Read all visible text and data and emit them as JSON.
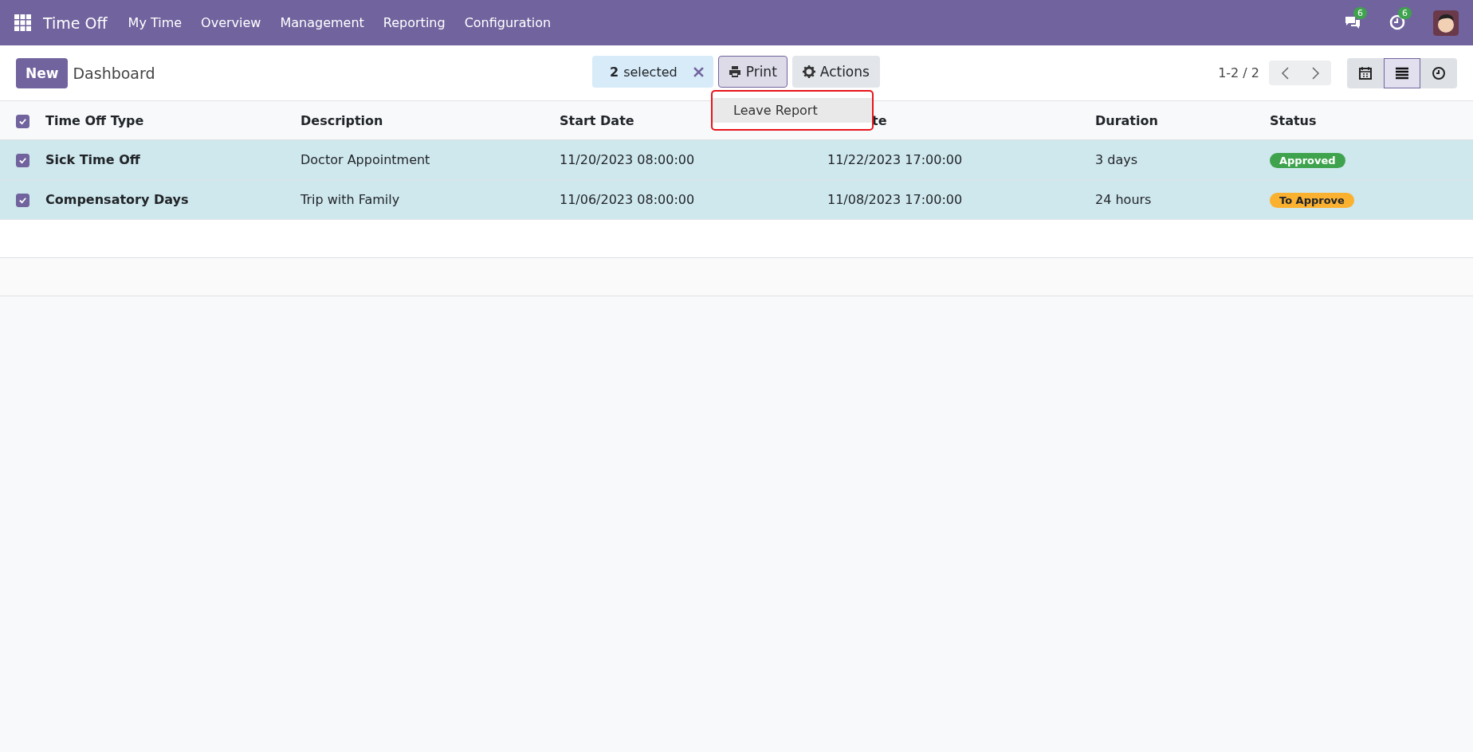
{
  "navbar": {
    "app_title": "Time Off",
    "menu": [
      "My Time",
      "Overview",
      "Management",
      "Reporting",
      "Configuration"
    ],
    "messages_count": "6",
    "activities_count": "6"
  },
  "control_panel": {
    "new_button": "New",
    "breadcrumb": "Dashboard",
    "selection": {
      "count": "2",
      "label": "selected"
    },
    "print_button": "Print",
    "actions_button": "Actions",
    "pager": "1-2 / 2",
    "views": [
      {
        "kind": "calendar",
        "selected": false
      },
      {
        "kind": "list",
        "selected": true
      },
      {
        "kind": "activity",
        "selected": false
      }
    ]
  },
  "print_menu": {
    "items": [
      "Leave Report"
    ],
    "highlighted": true
  },
  "table": {
    "all_checked": true,
    "columns": [
      "Time Off Type",
      "Description",
      "Start Date",
      "te",
      "Duration",
      "Status"
    ],
    "rows": [
      {
        "selected": true,
        "type": "Sick Time Off",
        "description": "Doctor Appointment",
        "start": "11/20/2023 08:00:00",
        "end": "11/22/2023 17:00:00",
        "duration": "3 days",
        "status": {
          "label": "Approved",
          "kind": "approved"
        }
      },
      {
        "selected": true,
        "type": "Compensatory Days",
        "description": "Trip with Family",
        "start": "11/06/2023 08:00:00",
        "end": "11/08/2023 17:00:00",
        "duration": "24 hours",
        "status": {
          "label": "To Approve",
          "kind": "pending"
        }
      }
    ]
  }
}
